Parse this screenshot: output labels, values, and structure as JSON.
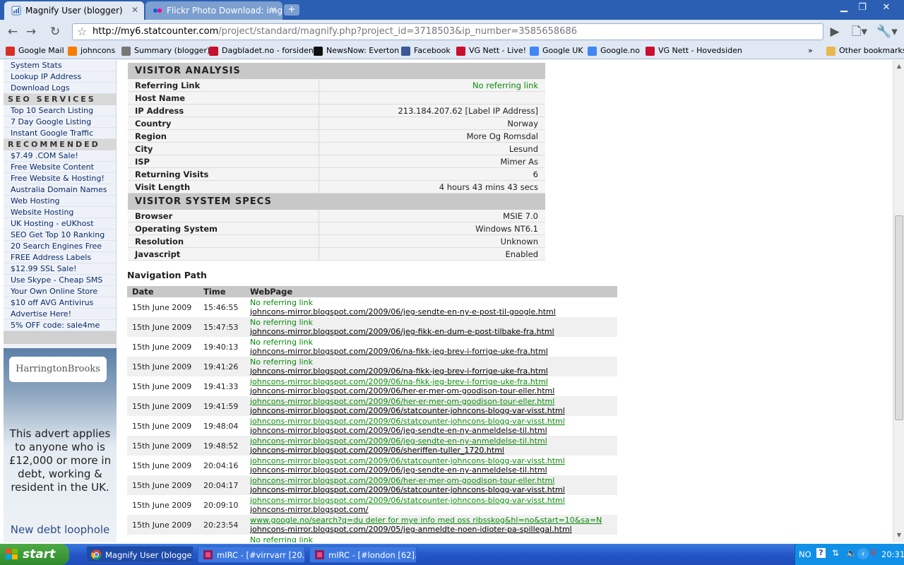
{
  "browser": {
    "tabs": [
      {
        "title": "Magnify User (blogger)",
        "icon": "statcounter-icon"
      },
      {
        "title": "Flickr Photo Download: img...",
        "icon": "flickr-icon"
      }
    ],
    "url_host": "http://my6.statcounter.com",
    "url_path": "/project/standard/magnify.php?project_id=3718503&ip_number=3585658686",
    "bookmarks": [
      {
        "label": "Google Mail",
        "icon": "gmail-icon",
        "color": "#d93025"
      },
      {
        "label": "johncons",
        "icon": "blogger-icon",
        "color": "#f57d00"
      },
      {
        "label": "Summary (blogger)",
        "icon": "statcounter-icon",
        "color": "#555555"
      },
      {
        "label": "Dagbladet.no - forsiden",
        "icon": "dagbladet-icon",
        "color": "#c8102e"
      },
      {
        "label": "NewsNow: Everton",
        "icon": "newsnow-icon",
        "color": "#111111"
      },
      {
        "label": "Facebook",
        "icon": "facebook-icon",
        "color": "#3b5998"
      },
      {
        "label": "VG Nett - Live!",
        "icon": "vg-icon",
        "color": "#c8102e"
      },
      {
        "label": "Google UK",
        "icon": "google-icon",
        "color": "#4285f4"
      },
      {
        "label": "Google.no",
        "icon": "google-icon",
        "color": "#4285f4"
      },
      {
        "label": "VG Nett - Hovedsiden",
        "icon": "vg-icon",
        "color": "#c8102e"
      }
    ],
    "other_bookmarks": "Other bookmarks",
    "overflow": "»"
  },
  "sidebar": {
    "group1": [
      "System Stats",
      "Lookup IP Address",
      "Download Logs"
    ],
    "seo_heading": "SEO SERVICES",
    "seo_items": [
      "Top 10 Search Listing",
      "7 Day Google Listing",
      "Instant Google Traffic"
    ],
    "rec_heading": "RECOMMENDED",
    "rec_items": [
      "$7.49 .COM Sale!",
      "Free Website Content",
      "Free Website & Hosting!",
      "Australia Domain Names",
      "Web Hosting",
      "Website Hosting",
      "UK Hosting - eUKhost",
      "SEO Get Top 10 Ranking",
      "20 Search Engines Free",
      "FREE Address Labels",
      "$12.99 SSL Sale!",
      "Use Skype - Cheap SMS",
      "Your Own Online Store",
      "$10 off AVG Antivirus",
      "Advertise Here!",
      "5% OFF code: sale4me"
    ],
    "ad": {
      "logo": "HarringtonBrooks",
      "text": "This advert applies to anyone who is £12,000 or more in debt, working & resident in the UK.",
      "link": "New debt loophole"
    }
  },
  "visitor_analysis": {
    "heading": "VISITOR ANALYSIS",
    "rows": [
      {
        "key": "Referring Link",
        "value": "No referring link",
        "green": true
      },
      {
        "key": "Host Name",
        "value": ""
      },
      {
        "key": "IP Address",
        "value": "213.184.207.62 [Label IP Address]"
      },
      {
        "key": "Country",
        "value": "Norway"
      },
      {
        "key": "Region",
        "value": "More Og Romsdal"
      },
      {
        "key": "City",
        "value": "Lesund"
      },
      {
        "key": "ISP",
        "value": "Mimer As"
      },
      {
        "key": "Returning Visits",
        "value": "6"
      },
      {
        "key": "Visit Length",
        "value": "4 hours 43 mins 43 secs"
      }
    ]
  },
  "system_specs": {
    "heading": "VISITOR SYSTEM SPECS",
    "rows": [
      {
        "key": "Browser",
        "value": "MSIE 7.0"
      },
      {
        "key": "Operating System",
        "value": "Windows NT6.1"
      },
      {
        "key": "Resolution",
        "value": "Unknown"
      },
      {
        "key": "Javascript",
        "value": "Enabled"
      }
    ]
  },
  "navigation": {
    "title": "Navigation Path",
    "headers": [
      "Date",
      "Time",
      "WebPage"
    ],
    "rows": [
      {
        "date": "15th June 2009",
        "time": "15:46:55",
        "ref": "No referring link",
        "ref_link": false,
        "page": "johncons-mirror.blogspot.com/2009/06/jeg-sendte-en-ny-e-post-til-google.html"
      },
      {
        "date": "15th June 2009",
        "time": "15:47:53",
        "ref": "No referring link",
        "ref_link": false,
        "page": "johncons-mirror.blogspot.com/2009/06/jeg-fikk-en-dum-e-post-tilbake-fra.html"
      },
      {
        "date": "15th June 2009",
        "time": "19:40:13",
        "ref": "No referring link",
        "ref_link": false,
        "page": "johncons-mirror.blogspot.com/2009/06/na-fikk-jeg-brev-i-forrige-uke-fra.html"
      },
      {
        "date": "15th June 2009",
        "time": "19:41:26",
        "ref": "No referring link",
        "ref_link": false,
        "page": "johncons-mirror.blogspot.com/2009/06/na-fikk-jeg-brev-i-forrige-uke-fra.html"
      },
      {
        "date": "15th June 2009",
        "time": "19:41:33",
        "ref": "johncons-mirror.blogspot.com/2009/06/na-fikk-jeg-brev-i-forrige-uke-fra.html",
        "ref_link": true,
        "page": "johncons-mirror.blogspot.com/2009/06/her-er-mer-om-goodison-tour-eller.html"
      },
      {
        "date": "15th June 2009",
        "time": "19:41:59",
        "ref": "johncons-mirror.blogspot.com/2009/06/her-er-mer-om-goodison-tour-eller.html",
        "ref_link": true,
        "page": "johncons-mirror.blogspot.com/2009/06/statcounter-johncons-blogg-var-visst.html"
      },
      {
        "date": "15th June 2009",
        "time": "19:48:04",
        "ref": "johncons-mirror.blogspot.com/2009/06/statcounter-johncons-blogg-var-visst.html",
        "ref_link": true,
        "page": "johncons-mirror.blogspot.com/2009/06/jeg-sendte-en-ny-anmeldelse-til.html"
      },
      {
        "date": "15th June 2009",
        "time": "19:48:52",
        "ref": "johncons-mirror.blogspot.com/2009/06/jeg-sendte-en-ny-anmeldelse-til.html",
        "ref_link": true,
        "page": "johncons-mirror.blogspot.com/2009/06/sheriffen-tuller_1720.html"
      },
      {
        "date": "15th June 2009",
        "time": "20:04:16",
        "ref": "johncons-mirror.blogspot.com/2009/06/statcounter-johncons-blogg-var-visst.html",
        "ref_link": true,
        "page": "johncons-mirror.blogspot.com/2009/06/jeg-sendte-en-ny-anmeldelse-til.html"
      },
      {
        "date": "15th June 2009",
        "time": "20:04:17",
        "ref": "johncons-mirror.blogspot.com/2009/06/her-er-mer-om-goodison-tour-eller.html",
        "ref_link": true,
        "page": "johncons-mirror.blogspot.com/2009/06/statcounter-johncons-blogg-var-visst.html"
      },
      {
        "date": "15th June 2009",
        "time": "20:09:10",
        "ref": "johncons-mirror.blogspot.com/2009/06/statcounter-johncons-blogg-var-visst.html",
        "ref_link": true,
        "page": "johncons-mirror.blogspot.com/"
      },
      {
        "date": "15th June 2009",
        "time": "20:23:54",
        "ref": "www.google.no/search?q=du deler for mye info med oss ribsskog&hl=no&start=10&sa=N",
        "ref_link": true,
        "page": "johncons-mirror.blogspot.com/2009/05/jeg-anmeldte-noen-idioter-pa-spillegal.html"
      },
      {
        "date": "",
        "time": "",
        "ref": "No referring link",
        "ref_link": false,
        "page": ""
      }
    ]
  },
  "taskbar": {
    "start": "start",
    "tasks": [
      {
        "label": "Magnify User (blogge...",
        "icon": "chrome-icon"
      },
      {
        "label": "mIRC - [#virrvarr [20...",
        "icon": "mirc-icon"
      },
      {
        "label": "mIRC - [#london [62]...",
        "icon": "mirc-icon"
      }
    ],
    "lang": "NO",
    "clock": "20:31"
  }
}
